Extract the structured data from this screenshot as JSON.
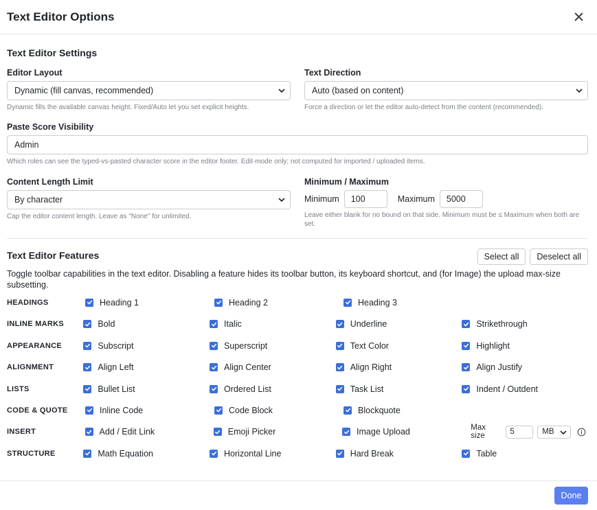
{
  "dialog": {
    "title": "Text Editor Options"
  },
  "settings": {
    "title": "Text Editor Settings",
    "editor_layout": {
      "label": "Editor Layout",
      "value": "Dynamic (fill canvas, recommended)",
      "help": "Dynamic fills the available canvas height. Fixed/Auto let you set explicit heights."
    },
    "text_direction": {
      "label": "Text Direction",
      "value": "Auto (based on content)",
      "help": "Force a direction or let the editor auto-detect from the content (recommended)."
    },
    "paste_score": {
      "label": "Paste Score Visibility",
      "value": "Admin",
      "help": "Which roles can see the typed-vs-pasted character score in the editor footer. Edit-mode only; not computed for imported / uploaded items."
    },
    "content_limit": {
      "label": "Content Length Limit",
      "value": "By character",
      "help": "Cap the editor content length. Leave as \"None\" for unlimited."
    },
    "min_max": {
      "label": "Minimum / Maximum",
      "min_label": "Minimum",
      "min_value": "100",
      "max_label": "Maximum",
      "max_value": "5000",
      "help": "Leave either blank for no bound on that side. Minimum must be ≤ Maximum when both are set."
    }
  },
  "features": {
    "title": "Text Editor Features",
    "select_all": "Select all",
    "deselect_all": "Deselect all",
    "description": "Toggle toolbar capabilities in the text editor. Disabling a feature hides its toolbar button, its keyboard shortcut, and (for Image) the upload max-size subsetting.",
    "groups": [
      {
        "name": "HEADINGS",
        "items": [
          "Heading 1",
          "Heading 2",
          "Heading 3"
        ]
      },
      {
        "name": "INLINE MARKS",
        "items": [
          "Bold",
          "Italic",
          "Underline",
          "Strikethrough"
        ]
      },
      {
        "name": "APPEARANCE",
        "items": [
          "Subscript",
          "Superscript",
          "Text Color",
          "Highlight"
        ]
      },
      {
        "name": "ALIGNMENT",
        "items": [
          "Align Left",
          "Align Center",
          "Align Right",
          "Align Justify"
        ]
      },
      {
        "name": "LISTS",
        "items": [
          "Bullet List",
          "Ordered List",
          "Task List",
          "Indent / Outdent"
        ]
      },
      {
        "name": "CODE & QUOTE",
        "items": [
          "Inline Code",
          "Code Block",
          "Blockquote"
        ]
      },
      {
        "name": "INSERT",
        "items": [
          "Add / Edit Link",
          "Emoji Picker",
          "Image Upload"
        ]
      },
      {
        "name": "STRUCTURE",
        "items": [
          "Math Equation",
          "Horizontal Line",
          "Hard Break",
          "Table"
        ]
      }
    ],
    "max_size": {
      "label": "Max size",
      "value": "5",
      "unit": "MB"
    }
  },
  "footer": {
    "done_label": "Done"
  },
  "colors": {
    "accent": "#3b6fd8",
    "primary_button": "#5a7ff0"
  },
  "icons": {
    "close": "close-icon",
    "dropdown": "chevron-down-icon",
    "checkbox": "check-icon",
    "info": "info-icon"
  }
}
